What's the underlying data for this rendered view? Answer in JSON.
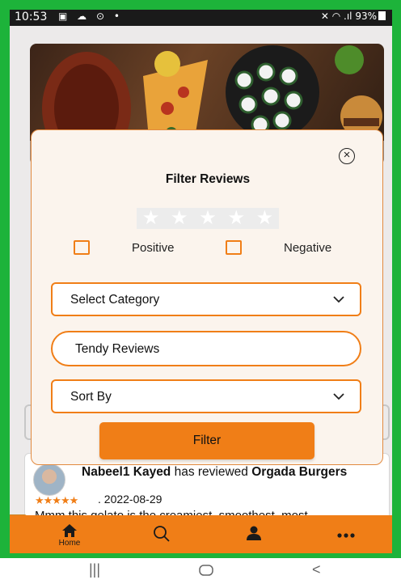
{
  "status_bar": {
    "time": "10:53",
    "battery": "93%",
    "left_icons": "▣ ☁ ⊙ •",
    "right_icons": "✕ ◠ .ıl"
  },
  "modal": {
    "title": "Filter Reviews",
    "rating_stars": 5,
    "positive_label": "Positive",
    "negative_label": "Negative",
    "category_select": "Select Category",
    "trendy_label": "Tendy Reviews",
    "sort_select": "Sort By",
    "filter_button": "Filter",
    "close_icon": "circle-x"
  },
  "review": {
    "reviewer": "Nabeel1 Kayed",
    "action": "has reviewed",
    "place": "Orgada Burgers",
    "date": ". 2022-08-29",
    "rating": 5,
    "snippet": "Mmm this gelato is the creamiest, smoothest, most"
  },
  "bottom_nav": {
    "home_label": "Home"
  },
  "colors": {
    "accent": "#f07e17",
    "frame": "#1db33a",
    "modal_bg": "#fbf4ed"
  }
}
